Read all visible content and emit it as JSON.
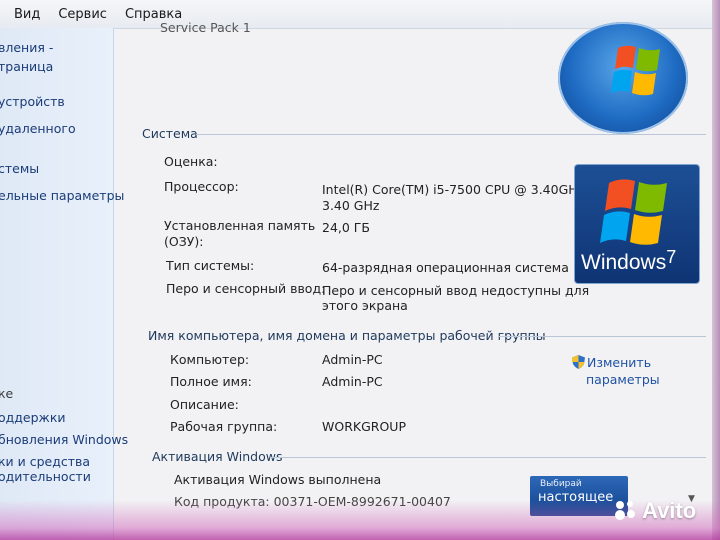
{
  "menu": {
    "view": "Вид",
    "service": "Сервис",
    "help": "Справка"
  },
  "left_pane": {
    "links": [
      "вления -",
      "траница",
      "устройств",
      "удаленного",
      "стемы",
      "ельные параметры"
    ],
    "see_also": "ке",
    "bottom_links": [
      "оддержки",
      "бновления Windows",
      "ки и средства",
      "одительности"
    ]
  },
  "content": {
    "prev_line": "Service Pack 1",
    "system": {
      "header": "Система",
      "rating_label": "Оценка:",
      "processor_label": "Процессор:",
      "processor_value": "Intel(R) Core(TM) i5-7500 CPU @ 3.40GHz",
      "processor_value2": "3.40 GHz",
      "memory_label": "Установленная память",
      "memory_label2": "(ОЗУ):",
      "memory_value": "24,0 ГБ",
      "type_label": "Тип системы:",
      "type_value": "64-разрядная операционная система",
      "pen_label": "Перо и сенсорный ввод:",
      "pen_value": "Перо и сенсорный ввод недоступны для",
      "pen_value2": "этого экрана"
    },
    "computer": {
      "header": "Имя компьютера, имя домена и параметры рабочей группы",
      "computer_label": "Компьютер:",
      "computer_value": "Admin-PC",
      "fullname_label": "Полное имя:",
      "fullname_value": "Admin-PC",
      "description_label": "Описание:",
      "workgroup_label": "Рабочая группа:",
      "workgroup_value": "WORKGROUP",
      "change_link": "Изменить",
      "change_link2": "параметры"
    },
    "activation": {
      "header": "Активация Windows",
      "status": "Активация Windows выполнена",
      "product_code": "Код продукта: 00371-OEM-8992671-00407"
    },
    "logo": {
      "text": "Windows",
      "version": "7"
    },
    "promo": {
      "small": "Выбирай",
      "big": "настоящее"
    },
    "watermark": "Avito"
  },
  "colors": {
    "link": "#1f52a3",
    "section": "#1e395b",
    "win_blue": "#1d4f95"
  }
}
